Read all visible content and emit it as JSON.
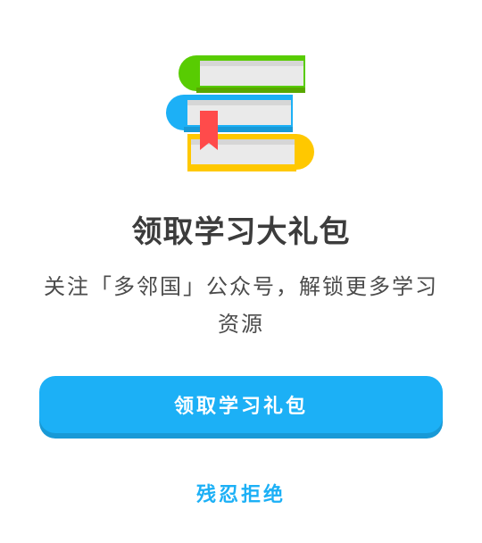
{
  "illustration": {
    "icon": "stacked-books-icon"
  },
  "dialog": {
    "title": "领取学习大礼包",
    "description": "关注「多邻国」公众号，解锁更多学习资源",
    "primary_button": "领取学习礼包",
    "secondary_button": "残忍拒绝"
  },
  "colors": {
    "accent": "#1cb0f6",
    "accent_shadow": "#1899d6",
    "book_top": "#58cc02",
    "book_middle": "#1cb0f6",
    "book_bottom": "#ffc800",
    "bookmark": "#ff4b4b"
  }
}
